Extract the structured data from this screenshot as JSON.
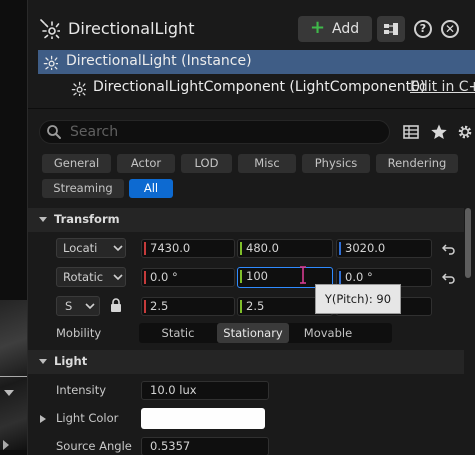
{
  "header": {
    "title": "DirectionalLight",
    "add_label": "Add",
    "help_glyph": "?",
    "close_glyph": "✕"
  },
  "tree": {
    "instance_label": "DirectionalLight (Instance)",
    "component_label": "DirectionalLightComponent (LightComponent0)",
    "edit_link": "Edit in C+"
  },
  "search": {
    "placeholder": "Search"
  },
  "filters": [
    {
      "label": "General",
      "active": false
    },
    {
      "label": "Actor",
      "active": false
    },
    {
      "label": "LOD",
      "active": false
    },
    {
      "label": "Misc",
      "active": false
    },
    {
      "label": "Physics",
      "active": false
    },
    {
      "label": "Rendering",
      "active": false
    },
    {
      "label": "Streaming",
      "active": false
    },
    {
      "label": "All",
      "active": true
    }
  ],
  "transform": {
    "section_label": "Transform",
    "location": {
      "label": "Locati",
      "x": "7430.0",
      "y": "480.0",
      "z": "3020.0"
    },
    "rotation": {
      "label": "Rotatic",
      "x": "0.0 °",
      "y": "100",
      "z": "0.0 °"
    },
    "scale": {
      "label": "S",
      "x": "2.5",
      "y": "2.5"
    },
    "mobility": {
      "label": "Mobility",
      "options": [
        "Static",
        "Stationary",
        "Movable"
      ],
      "selected": "Stationary"
    },
    "tooltip": "Y(Pitch): 90"
  },
  "light": {
    "section_label": "Light",
    "intensity": {
      "label": "Intensity",
      "value": "10.0 lux"
    },
    "light_color": {
      "label": "Light Color",
      "color": "#ffffff"
    },
    "source_angle": {
      "label": "Source Angle",
      "value": "0.5357"
    }
  },
  "colors": {
    "axis_x": "#c63b3b",
    "axis_y": "#7fbf2a",
    "axis_z": "#2f6fd6",
    "selection": "#3f5d86",
    "accent": "#0d6ad1"
  },
  "icons": [
    "light-icon",
    "blueprint-icon",
    "help-icon",
    "close-icon",
    "search-icon",
    "grid-view-icon",
    "star-icon",
    "settings-icon",
    "reset-icon",
    "lock-icon"
  ]
}
